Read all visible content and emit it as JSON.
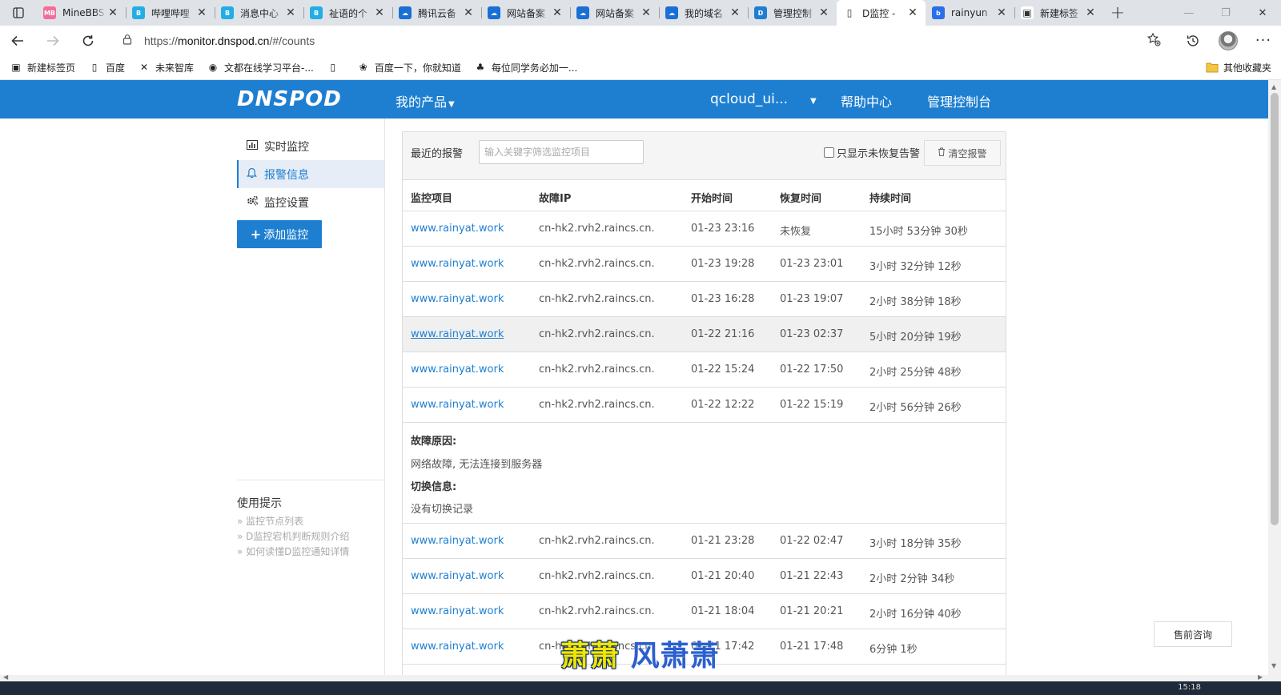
{
  "browser": {
    "tabs": [
      {
        "title": "MineBBS",
        "fav": "MB",
        "color": "#f26d99",
        "active": false
      },
      {
        "title": "哔哩哔哩",
        "fav": "B",
        "color": "#23ade5",
        "active": false
      },
      {
        "title": "消息中心",
        "fav": "B",
        "color": "#23ade5",
        "active": false
      },
      {
        "title": "祉语的个",
        "fav": "B",
        "color": "#23ade5",
        "active": false
      },
      {
        "title": "腾讯云备",
        "fav": "☁",
        "color": "#1a6fd4",
        "active": false
      },
      {
        "title": "网站备案",
        "fav": "☁",
        "color": "#1a6fd4",
        "active": false
      },
      {
        "title": "网站备案",
        "fav": "☁",
        "color": "#1a6fd4",
        "active": false
      },
      {
        "title": "我的域名",
        "fav": "☁",
        "color": "#1a6fd4",
        "active": false
      },
      {
        "title": "管理控制",
        "fav": "D",
        "color": "#1e7fd1",
        "active": false
      },
      {
        "title": "D监控 -",
        "fav": "▯",
        "color": "#ffffff",
        "active": true
      },
      {
        "title": "rainyun",
        "fav": "b",
        "color": "#2a6ee8",
        "active": false
      },
      {
        "title": "新建标签",
        "fav": "▣",
        "color": "#ffffff",
        "active": false
      }
    ],
    "url_prefix": "https://",
    "url_domain": "monitor.dnspod.cn",
    "url_path": "/#/counts",
    "bookmarks": [
      {
        "label": "新建标签页",
        "icon": "▣"
      },
      {
        "label": "百度",
        "icon": "▯"
      },
      {
        "label": "未来智库",
        "icon": "✕"
      },
      {
        "label": "文都在线学习平台-...",
        "icon": "◉"
      },
      {
        "label": "",
        "icon": "▯"
      },
      {
        "label": "百度一下，你就知道",
        "icon": "❀"
      },
      {
        "label": "每位同学务必加一...",
        "icon": "♣"
      }
    ],
    "bookmarks_other": "其他收藏夹"
  },
  "header": {
    "logo": "DNSPOD",
    "products": "我的产品",
    "account": "qcloud_ui...",
    "help": "帮助中心",
    "console": "管理控制台"
  },
  "sidebar": {
    "items": [
      {
        "label": "实时监控",
        "icon": "▥"
      },
      {
        "label": "报警信息",
        "icon": "🔔"
      },
      {
        "label": "监控设置",
        "icon": "⚙"
      }
    ],
    "add_button": "添加监控",
    "tips_title": "使用提示",
    "tips": [
      "监控节点列表",
      "D监控宕机判断规则介绍",
      "如何读懂D监控通知详情"
    ]
  },
  "alerts": {
    "label": "最近的报警",
    "search_placeholder": "输入关键字筛选监控项目",
    "only_unrecovered": "只显示未恢复告警",
    "clear_button": "清空报警",
    "columns": [
      "监控项目",
      "故障IP",
      "开始时间",
      "恢复时间",
      "持续时间"
    ],
    "rows_top": [
      {
        "item": "www.rainyat.work",
        "ip": "cn-hk2.rvh2.raincs.cn.",
        "start": "01-23 23:16",
        "recover": "未恢复",
        "duration": "15小时 53分钟 30秒"
      },
      {
        "item": "www.rainyat.work",
        "ip": "cn-hk2.rvh2.raincs.cn.",
        "start": "01-23 19:28",
        "recover": "01-23 23:01",
        "duration": "3小时 32分钟 12秒"
      },
      {
        "item": "www.rainyat.work",
        "ip": "cn-hk2.rvh2.raincs.cn.",
        "start": "01-23 16:28",
        "recover": "01-23 19:07",
        "duration": "2小时 38分钟 18秒"
      },
      {
        "item": "www.rainyat.work",
        "ip": "cn-hk2.rvh2.raincs.cn.",
        "start": "01-22 21:16",
        "recover": "01-23 02:37",
        "duration": "5小时 20分钟 19秒"
      },
      {
        "item": "www.rainyat.work",
        "ip": "cn-hk2.rvh2.raincs.cn.",
        "start": "01-22 15:24",
        "recover": "01-22 17:50",
        "duration": "2小时 25分钟 48秒"
      },
      {
        "item": "www.rainyat.work",
        "ip": "cn-hk2.rvh2.raincs.cn.",
        "start": "01-22 12:22",
        "recover": "01-22 15:19",
        "duration": "2小时 56分钟 26秒"
      }
    ],
    "detail": {
      "reason_label": "故障原因:",
      "reason": "网络故障, 无法连接到服务器",
      "switch_label": "切换信息:",
      "switch": "没有切换记录"
    },
    "rows_bottom": [
      {
        "item": "www.rainyat.work",
        "ip": "cn-hk2.rvh2.raincs.cn.",
        "start": "01-21 23:28",
        "recover": "01-22 02:47",
        "duration": "3小时 18分钟 35秒"
      },
      {
        "item": "www.rainyat.work",
        "ip": "cn-hk2.rvh2.raincs.cn.",
        "start": "01-21 20:40",
        "recover": "01-21 22:43",
        "duration": "2小时 2分钟 34秒"
      },
      {
        "item": "www.rainyat.work",
        "ip": "cn-hk2.rvh2.raincs.cn.",
        "start": "01-21 18:04",
        "recover": "01-21 20:21",
        "duration": "2小时 16分钟 40秒"
      },
      {
        "item": "www.rainyat.work",
        "ip": "cn-hk2.rvh2.raincs.cn.",
        "start": "01-21 17:42",
        "recover": "01-21 17:48",
        "duration": "6分钟 1秒"
      }
    ]
  },
  "presale": "售前咨询",
  "watermark": [
    "萧萧",
    "风萧萧"
  ],
  "clock": "15:18"
}
